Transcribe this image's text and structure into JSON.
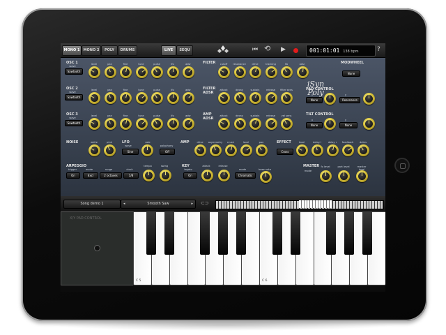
{
  "topbar": {
    "tabs": [
      {
        "label": "MONO 1",
        "active": true
      },
      {
        "label": "MONO 2",
        "active": false
      },
      {
        "label": "POLY",
        "active": false
      },
      {
        "label": "DRUMS",
        "active": false
      }
    ],
    "mode_tabs": [
      {
        "label": "LIVE",
        "active": true
      },
      {
        "label": "SEQU",
        "active": false
      }
    ],
    "transport": {
      "rewind": "⏮",
      "loop": "⟲",
      "play": "▶",
      "record_color": "#e21b1b"
    },
    "time": "001:01:01",
    "bpm": "138 bpm",
    "help": "?"
  },
  "osc1": {
    "title": "OSC 1",
    "wave_label": "wave",
    "wave_value": "Sawtooth",
    "knobs": [
      "level",
      "pan",
      "fine",
      "tune",
      "pulse",
      "lfo",
      "adsr"
    ]
  },
  "osc2": {
    "title": "OSC 2",
    "wave_label": "wave",
    "wave_value": "Sawtooth",
    "knobs": [
      "level",
      "pan",
      "fine",
      "tune",
      "pulse",
      "lfo",
      "adsr"
    ]
  },
  "osc3": {
    "title": "OSC 3",
    "wave_label": "wave",
    "wave_value": "Sawtooth",
    "knobs": [
      "level",
      "pan",
      "fine",
      "tune",
      "pulse",
      "lfo",
      "adsr"
    ]
  },
  "filter": {
    "title": "FILTER",
    "knobs": [
      "cutoff",
      "resonance",
      "drive",
      "tracking",
      "lfo",
      "adsr"
    ]
  },
  "filter_adsr": {
    "title": "FILTER ADSR",
    "knobs": [
      "attack",
      "decay",
      "sustain",
      "release",
      "filter sens"
    ]
  },
  "amp_adsr": {
    "title": "AMP ADSR",
    "knobs": [
      "attack",
      "decay",
      "sustain",
      "release",
      "vel sens"
    ]
  },
  "brand": "iSyn Poly",
  "modwheel": {
    "title": "MODWHEEL",
    "value": "None"
  },
  "pad_control": {
    "title": "PAD CONTROL",
    "x_label": "x",
    "x_value": "None",
    "y_label": "y",
    "y_value": "Resonance"
  },
  "tilt_control": {
    "title": "TILT CONTROL",
    "x_label": "x",
    "x_value": "None",
    "y_label": "y",
    "y_value": "None"
  },
  "noise": {
    "title": "NOISE",
    "knobs": [
      "white",
      "pink"
    ]
  },
  "lfo": {
    "title": "LFO",
    "wave_label": "wave",
    "wave_value": "Sine",
    "rate_label": "rate",
    "poly_label": "polyphony",
    "poly_value": "Off"
  },
  "amp": {
    "title": "AMP",
    "knobs": [
      "drive",
      "asymmetry",
      "crush",
      "level",
      "pan"
    ]
  },
  "effect": {
    "title": "EFFECT",
    "value": "Cross",
    "knobs": [
      "level",
      "delay l",
      "delay r",
      "feedback",
      "detns"
    ]
  },
  "arpeggio": {
    "title": "ARPEGGIO",
    "trigger_label": "trigger",
    "trigger_value": "On",
    "mode_label": "mode",
    "mode_value": "Excl",
    "range_label": "range",
    "range_value": "2 octaves",
    "clock_label": "clock",
    "clock_value": "1/8",
    "tempo_label": "tempo",
    "swing_label": "swing"
  },
  "key": {
    "title": "KEY",
    "legato_label": "legato",
    "legato_value": "On",
    "attack_label": "attack",
    "release_label": "release",
    "mode_label": "mode",
    "mode_value": "Chromatic",
    "basenote_label": "base note",
    "basenote_value": "C"
  },
  "master": {
    "title": "MASTER",
    "mode_label": "mode",
    "knobs": [
      "fx level",
      "part level",
      "master level"
    ]
  },
  "bar2": {
    "song": "Song demo 1",
    "prev": "◂",
    "patch": "Smooth Saw",
    "next": "▸",
    "link_icon": "⊂⊃"
  },
  "xy_pad": {
    "title": "X/Y PAD CONTROL"
  },
  "keyboard": {
    "labels": [
      "C 5",
      "C 6"
    ]
  }
}
